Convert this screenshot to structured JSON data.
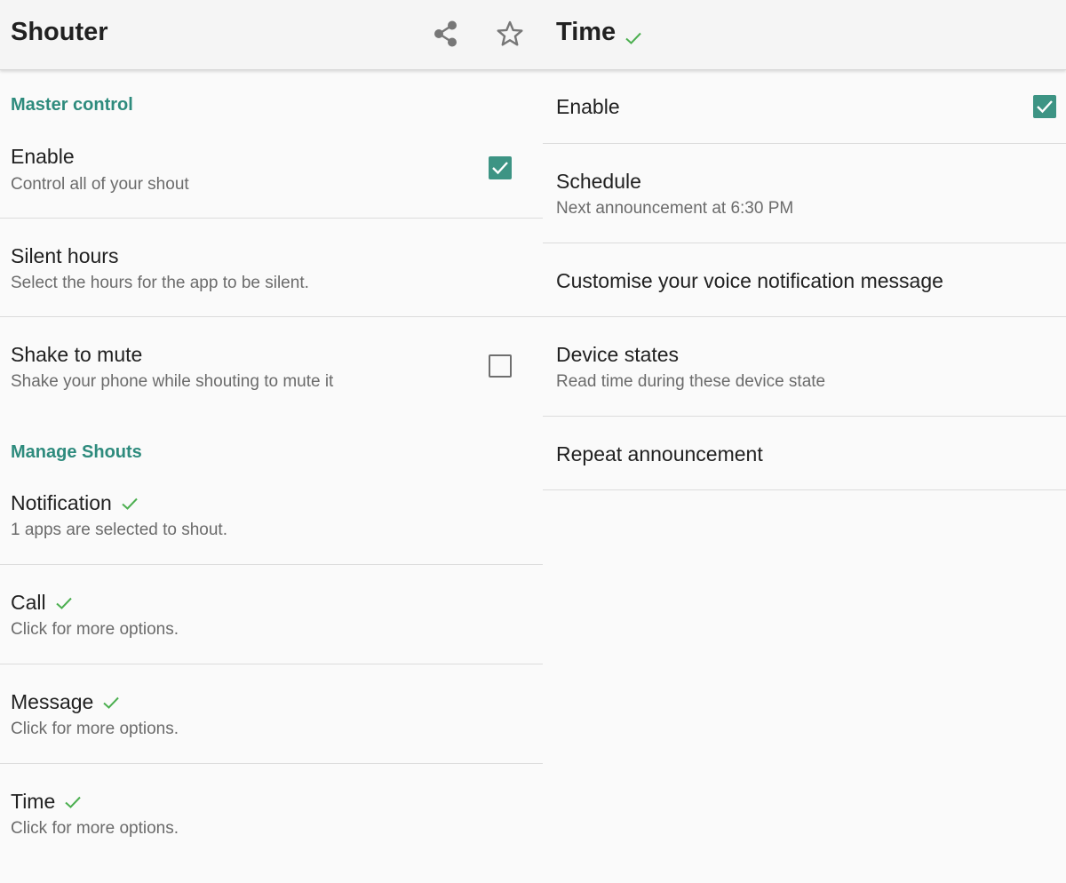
{
  "left": {
    "app_title": "Shouter",
    "toolbar_icons": [
      "share-icon",
      "star-outline-icon"
    ],
    "sections": {
      "master_control": "Master control",
      "manage_shouts": "Manage Shouts"
    },
    "prefs": {
      "enable": {
        "title": "Enable",
        "summary": "Control all of your shout",
        "checked": true
      },
      "silent_hours": {
        "title": "Silent hours",
        "summary": "Select the hours for the app to be silent."
      },
      "shake_to_mute": {
        "title": "Shake to mute",
        "summary": "Shake your phone while shouting to mute it",
        "checked": false
      },
      "notification": {
        "title": "Notification",
        "summary": " 1 apps are selected to shout.",
        "enabled_mark": true
      },
      "call": {
        "title": "Call",
        "summary": "Click for more options.",
        "enabled_mark": true
      },
      "message": {
        "title": "Message",
        "summary": "Click for more options.",
        "enabled_mark": true
      },
      "time": {
        "title": "Time",
        "summary": "Click for more options.",
        "enabled_mark": true
      }
    }
  },
  "right": {
    "title": "Time",
    "title_mark": true,
    "prefs": {
      "enable": {
        "title": "Enable",
        "checked": true
      },
      "schedule": {
        "title": "Schedule",
        "summary": "Next announcement at 6:30 PM"
      },
      "customise": {
        "title": "Customise your voice notification message"
      },
      "device_states": {
        "title": "Device states",
        "summary": "Read time during these device state"
      },
      "repeat": {
        "title": "Repeat announcement"
      }
    }
  },
  "colors": {
    "accent": "#3d9484",
    "section_header": "#2e8b7d",
    "check_green": "#4caf50",
    "appbar_bg": "#f5f5f5",
    "background": "#fafafa"
  }
}
